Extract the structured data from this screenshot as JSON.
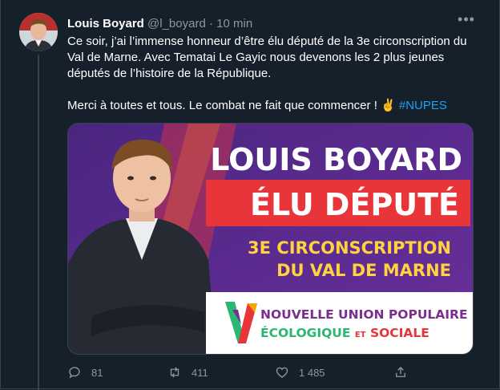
{
  "tweet": {
    "author_name": "Louis Boyard",
    "handle": "@l_boyard",
    "separator": "·",
    "time": "10 min",
    "text_line1": "Ce soir, j’ai l’immense honneur d’être élu député de la 3e circonscription du Val de Marne. Avec Tematai Le Gayic nous devenons les 2 plus jeunes députés de l’histoire de la République.",
    "text_line2": "Merci à toutes et tous. Le combat ne fait que commencer ! ✌️",
    "hashtag": "#NUPES"
  },
  "media": {
    "headline": "LOUIS BOYARD",
    "banner": "ÉLU DÉPUTÉ",
    "subtitle_line1": "3E CIRCONSCRIPTION",
    "subtitle_line2": "DU VAL DE MARNE",
    "logo_line1": "NOUVELLE UNION POPULAIRE",
    "logo_line2a": "ÉCOLOGIQUE",
    "logo_line2b": "ET",
    "logo_line2c": "SOCIALE"
  },
  "actions": {
    "replies": "81",
    "retweets": "411",
    "likes": "1 485"
  },
  "colors": {
    "background": "#15202b",
    "muted": "#8899a6",
    "link": "#1da1f2",
    "poster_purple": "#5a2b91",
    "banner_red": "#e8353a",
    "subtitle_yellow": "#ffd23f"
  },
  "icons": [
    "more-icon",
    "reply-icon",
    "retweet-icon",
    "like-icon",
    "share-icon"
  ]
}
